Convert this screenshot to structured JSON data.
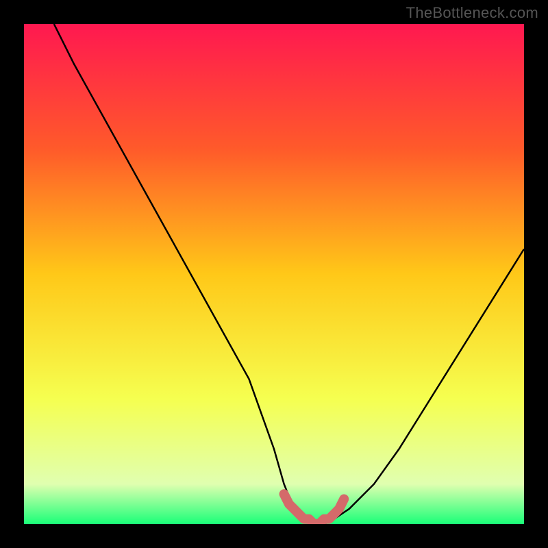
{
  "watermark": "TheBottleneck.com",
  "chart_data": {
    "type": "line",
    "title": "",
    "xlabel": "",
    "ylabel": "",
    "xlim": [
      0,
      100
    ],
    "ylim": [
      0,
      100
    ],
    "series": [
      {
        "name": "bottleneck-curve",
        "x": [
          6,
          10,
          15,
          20,
          25,
          30,
          35,
          40,
          45,
          50,
          52,
          54,
          56,
          58,
          60,
          62,
          65,
          70,
          75,
          80,
          85,
          90,
          95,
          100
        ],
        "y": [
          100,
          92,
          83,
          74,
          65,
          56,
          47,
          38,
          29,
          15,
          8,
          3,
          1,
          0,
          0,
          1,
          3,
          8,
          15,
          23,
          31,
          39,
          47,
          55
        ]
      },
      {
        "name": "optimal-marker",
        "x": [
          52,
          53,
          54,
          55,
          56,
          57,
          58,
          59,
          60,
          61,
          62,
          63,
          64
        ],
        "y": [
          6,
          4,
          3,
          2,
          1,
          1,
          0,
          0,
          1,
          1,
          2,
          3,
          5
        ]
      }
    ],
    "gradient_stops": [
      {
        "offset": 0,
        "color": "#ff1850"
      },
      {
        "offset": 25,
        "color": "#ff5a2a"
      },
      {
        "offset": 50,
        "color": "#ffc818"
      },
      {
        "offset": 75,
        "color": "#f5ff50"
      },
      {
        "offset": 92,
        "color": "#e0ffb0"
      },
      {
        "offset": 100,
        "color": "#1aff78"
      }
    ]
  }
}
